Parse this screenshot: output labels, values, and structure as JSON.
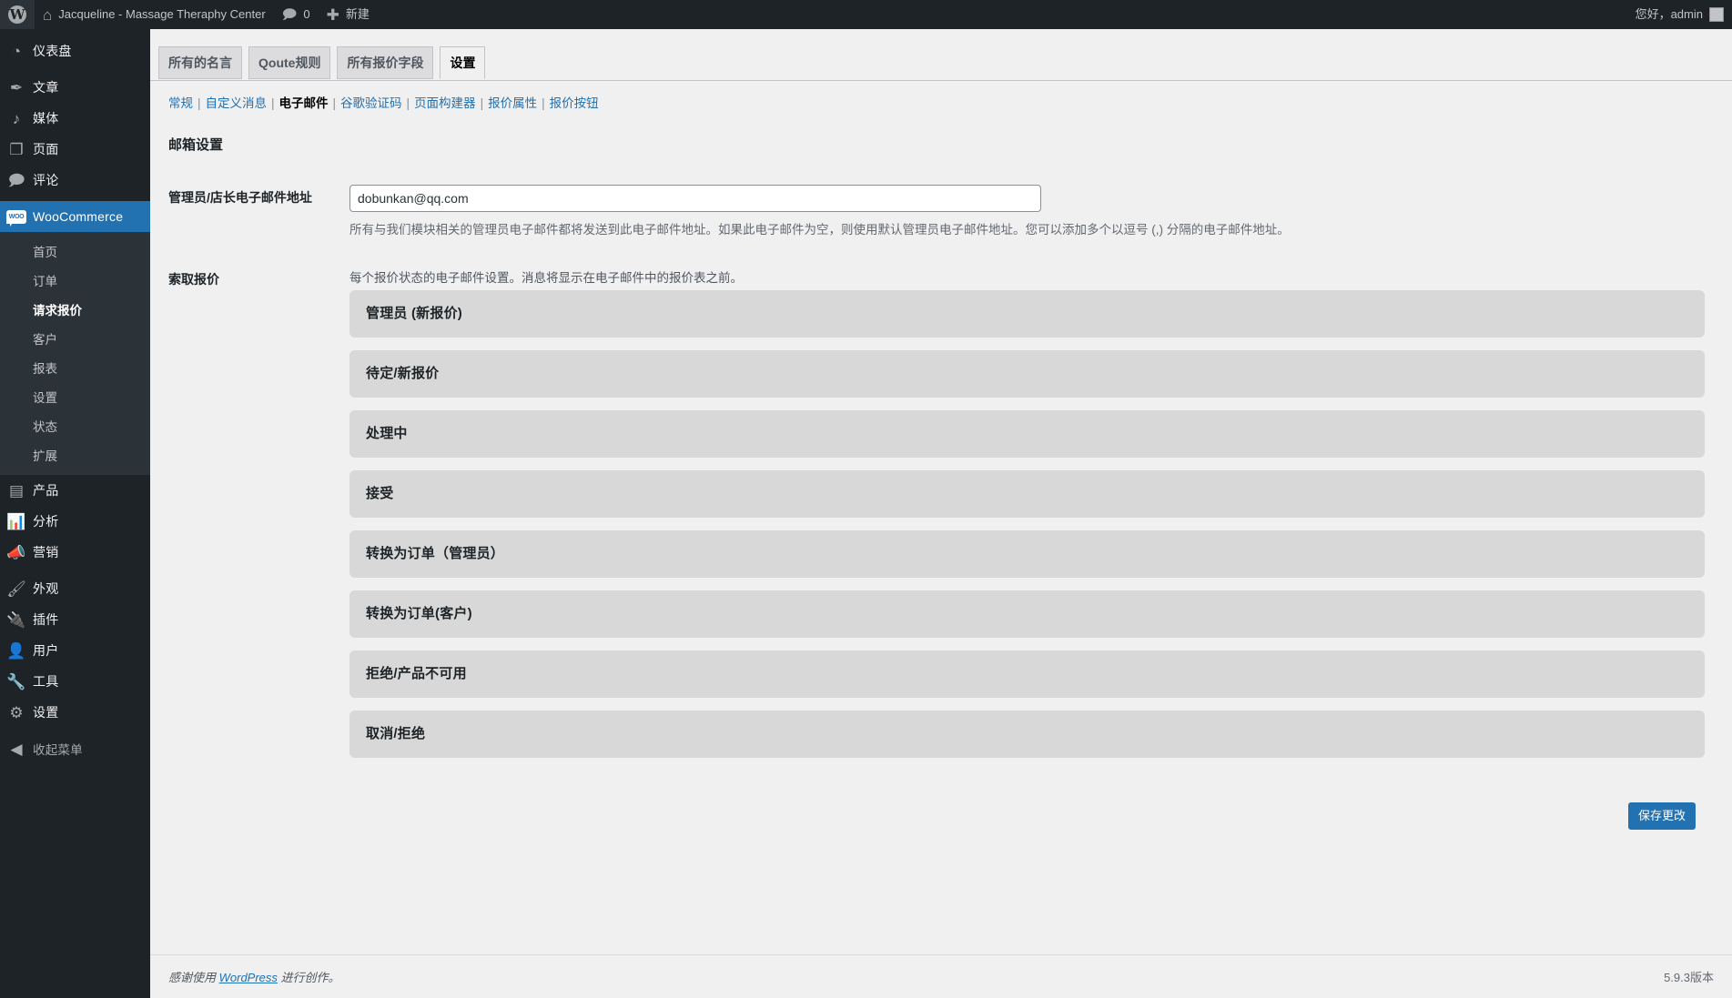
{
  "adminbar": {
    "wp_logo": "wordpress-logo",
    "site_name": "Jacqueline - Massage Theraphy Center",
    "comments_count": "0",
    "new_label": "新建",
    "howdy": "您好，admin"
  },
  "sidebar": {
    "items": [
      {
        "label": "仪表盘",
        "icon": "dashboard-icon",
        "name": "sidebar-item-dashboard",
        "current": false,
        "sep_after": true
      },
      {
        "label": "文章",
        "icon": "posts-pin-icon",
        "name": "sidebar-item-posts",
        "current": false
      },
      {
        "label": "媒体",
        "icon": "media-icon",
        "name": "sidebar-item-media",
        "current": false
      },
      {
        "label": "页面",
        "icon": "pages-icon",
        "name": "sidebar-item-pages",
        "current": false
      },
      {
        "label": "评论",
        "icon": "comments-icon",
        "name": "sidebar-item-comments",
        "current": false,
        "sep_after": true
      }
    ],
    "woocommerce": {
      "label": "WooCommerce",
      "icon": "woocommerce-icon",
      "name": "sidebar-item-woocommerce",
      "submenu": [
        {
          "label": "首页",
          "name": "sidebar-subitem-home",
          "current": false
        },
        {
          "label": "订单",
          "name": "sidebar-subitem-orders",
          "current": false
        },
        {
          "label": "请求报价",
          "name": "sidebar-subitem-request-quote",
          "current": true
        },
        {
          "label": "客户",
          "name": "sidebar-subitem-customers",
          "current": false
        },
        {
          "label": "报表",
          "name": "sidebar-subitem-reports",
          "current": false
        },
        {
          "label": "设置",
          "name": "sidebar-subitem-settings",
          "current": false
        },
        {
          "label": "状态",
          "name": "sidebar-subitem-status",
          "current": false
        },
        {
          "label": "扩展",
          "name": "sidebar-subitem-extensions",
          "current": false
        }
      ]
    },
    "items_after": [
      {
        "label": "产品",
        "icon": "products-icon",
        "name": "sidebar-item-products",
        "current": false
      },
      {
        "label": "分析",
        "icon": "analytics-bar-icon",
        "name": "sidebar-item-analytics",
        "current": false
      },
      {
        "label": "营销",
        "icon": "marketing-megaphone-icon",
        "name": "sidebar-item-marketing",
        "current": false,
        "sep_after": true
      },
      {
        "label": "外观",
        "icon": "appearance-brush-icon",
        "name": "sidebar-item-appearance",
        "current": false
      },
      {
        "label": "插件",
        "icon": "plugins-plug-icon",
        "name": "sidebar-item-plugins",
        "current": false
      },
      {
        "label": "用户",
        "icon": "users-icon",
        "name": "sidebar-item-users",
        "current": false
      },
      {
        "label": "工具",
        "icon": "tools-wrench-icon",
        "name": "sidebar-item-tools",
        "current": false
      },
      {
        "label": "设置",
        "icon": "settings-sliders-icon",
        "name": "sidebar-item-settings",
        "current": false,
        "sep_after": true
      }
    ],
    "collapse": {
      "label": "收起菜单",
      "icon": "collapse-arrow-icon",
      "name": "collapse-menu-button"
    }
  },
  "tabs": [
    {
      "label": "所有的名言",
      "name": "tab-all-quotes",
      "active": false
    },
    {
      "label": "Qoute规则",
      "name": "tab-quote-rules",
      "active": false
    },
    {
      "label": "所有报价字段",
      "name": "tab-all-quote-fields",
      "active": false
    },
    {
      "label": "设置",
      "name": "tab-settings",
      "active": true
    }
  ],
  "subtabs": [
    {
      "label": "常规",
      "name": "subtab-general",
      "current": false
    },
    {
      "label": "自定义消息",
      "name": "subtab-custom-message",
      "current": false
    },
    {
      "label": "电子邮件",
      "name": "subtab-emails",
      "current": true
    },
    {
      "label": "谷歌验证码",
      "name": "subtab-google-recaptcha",
      "current": false
    },
    {
      "label": "页面构建器",
      "name": "subtab-page-builder",
      "current": false
    },
    {
      "label": "报价属性",
      "name": "subtab-quote-attributes",
      "current": false
    },
    {
      "label": "报价按钮",
      "name": "subtab-quote-button",
      "current": false
    }
  ],
  "main": {
    "section_title": "邮箱设置",
    "admin_email": {
      "label": "管理员/店长电子邮件地址",
      "value": "dobunkan@qq.com",
      "placeholder": "",
      "description": "所有与我们模块相关的管理员电子邮件都将发送到此电子邮件地址。如果此电子邮件为空，则使用默认管理员电子邮件地址。您可以添加多个以逗号 (,) 分隔的电子邮件地址。"
    },
    "request_quote": {
      "label": "索取报价",
      "description": "每个报价状态的电子邮件设置。消息将显示在电子邮件中的报价表之前。",
      "panels": [
        {
          "title": "管理员 (新报价)",
          "name": "accordion-admin-new-quote"
        },
        {
          "title": "待定/新报价",
          "name": "accordion-pending-new-quote"
        },
        {
          "title": "处理中",
          "name": "accordion-processing"
        },
        {
          "title": "接受",
          "name": "accordion-accepted"
        },
        {
          "title": "转换为订单（管理员）",
          "name": "accordion-convert-order-admin"
        },
        {
          "title": "转换为订单(客户)",
          "name": "accordion-convert-order-customer"
        },
        {
          "title": "拒绝/产品不可用",
          "name": "accordion-rejected-unavailable"
        },
        {
          "title": "取消/拒绝",
          "name": "accordion-cancelled-declined"
        }
      ]
    },
    "save_button": "保存更改"
  },
  "footer": {
    "thanks_prefix": "感谢使用 ",
    "wordpress_link": "WordPress",
    "thanks_suffix": " 进行创作。",
    "version": "5.9.3版本"
  },
  "colors": {
    "admin_bar_bg": "#1d2327",
    "sidebar_bg": "#1d2327",
    "submenu_bg": "#2c3338",
    "accent_blue": "#2271b1",
    "content_bg": "#f0f0f1",
    "panel_bg": "#d8d8d8",
    "link_blue": "#2271b1"
  }
}
